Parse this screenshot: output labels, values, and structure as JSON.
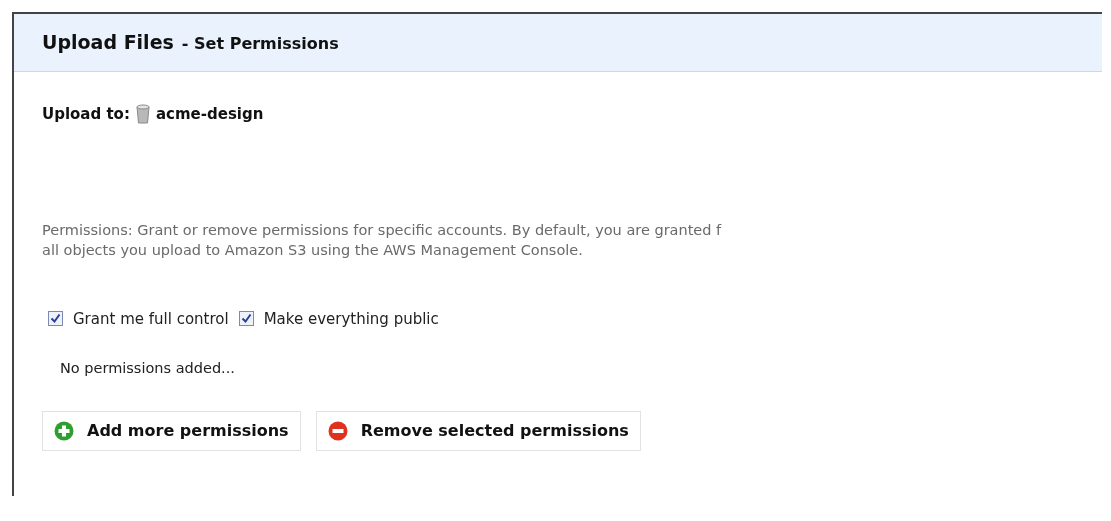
{
  "panel": {
    "title": "Upload Files",
    "subtitle": "- Set Permissions"
  },
  "upload_to": {
    "label": "Upload to:",
    "bucket": "acme-design"
  },
  "description": [
    "Permissions: Grant or remove permissions for specific accounts. By default, you are granted f",
    "all objects you upload to Amazon S3 using the AWS Management Console."
  ],
  "options": [
    {
      "label": "Grant me full control",
      "checked": true
    },
    {
      "label": "Make everything public",
      "checked": true
    }
  ],
  "empty_message": "No permissions added...",
  "buttons": [
    {
      "kind": "add",
      "label": "Add more permissions"
    },
    {
      "kind": "remove",
      "label": "Remove selected permissions"
    }
  ]
}
